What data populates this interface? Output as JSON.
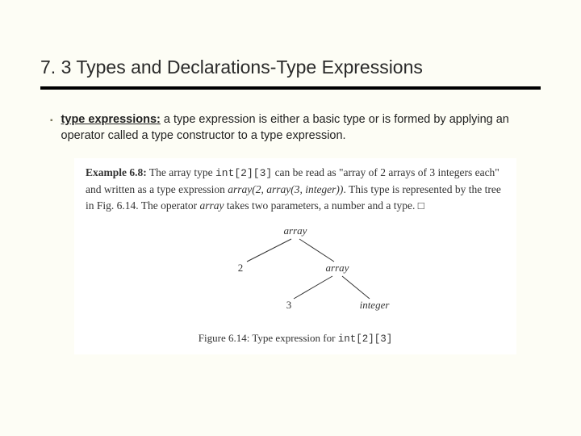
{
  "title": "7. 3 Types and Declarations-Type Expressions",
  "bullet": {
    "marker": "▪",
    "term": "type expressions:",
    "rest": " a type expression is either a basic type or is formed by applying an operator called a type constructor to a type expression."
  },
  "example": {
    "label": "Example 6.8:",
    "p1a": " The array type ",
    "code1": "int[2][3]",
    "p1b": " can be read as \"array of 2 arrays of 3 integers each\" and written as a type expression ",
    "expr": "array(2, array(3, integer))",
    "p1c": ". This type is represented by the tree in Fig. 6.14. The operator ",
    "op": "array",
    "p1d": " takes two parameters, a number and a type.   □"
  },
  "tree": {
    "root": "array",
    "left1": "2",
    "right1": "array",
    "left2": "3",
    "right2": "integer"
  },
  "figcap": {
    "pre": "Figure 6.14: Type expression for ",
    "code": "int[2][3]"
  }
}
